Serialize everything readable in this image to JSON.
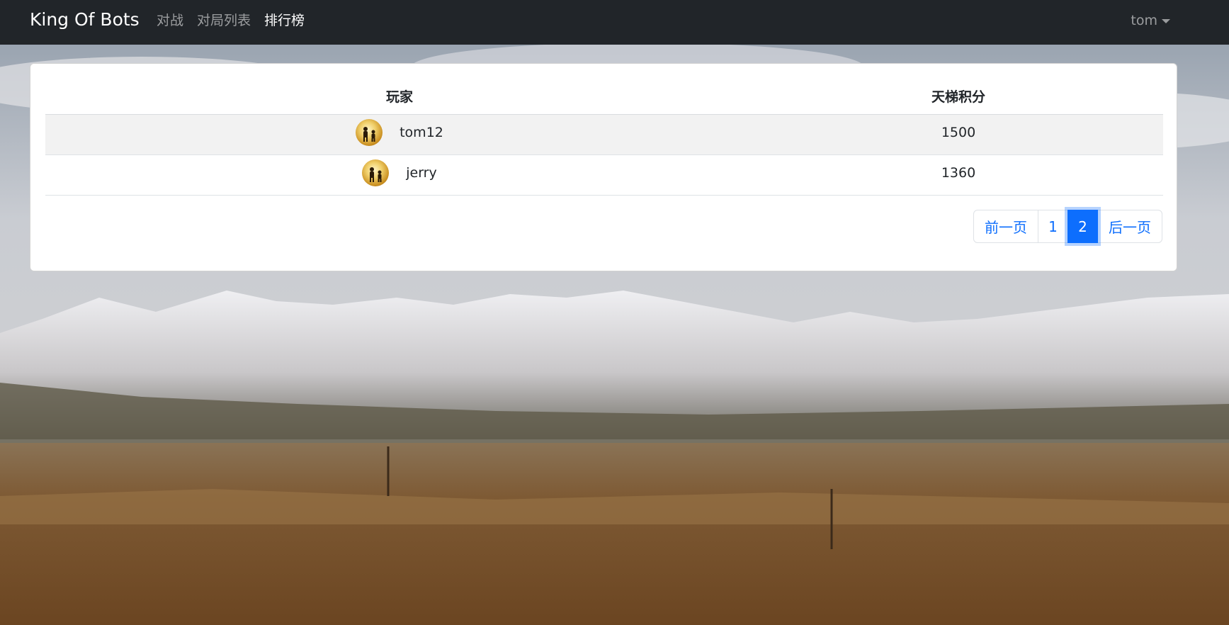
{
  "app": {
    "brand": "King Of Bots"
  },
  "nav": {
    "items": [
      {
        "label": "对战",
        "active": false
      },
      {
        "label": "对局列表",
        "active": false
      },
      {
        "label": "排行榜",
        "active": true
      }
    ],
    "user": "tom"
  },
  "ranklist": {
    "headers": {
      "player": "玩家",
      "rating": "天梯积分"
    },
    "rows": [
      {
        "username": "tom12",
        "rating": "1500",
        "avatar": "avatar-icon"
      },
      {
        "username": "jerry",
        "rating": "1360",
        "avatar": "avatar-icon"
      }
    ]
  },
  "pagination": {
    "prev": "前一页",
    "pages": [
      "1",
      "2"
    ],
    "current": "2",
    "next": "后一页"
  },
  "colors": {
    "navbar_bg": "#212529",
    "accent": "#0d6efd",
    "card_bg": "#ffffff"
  }
}
